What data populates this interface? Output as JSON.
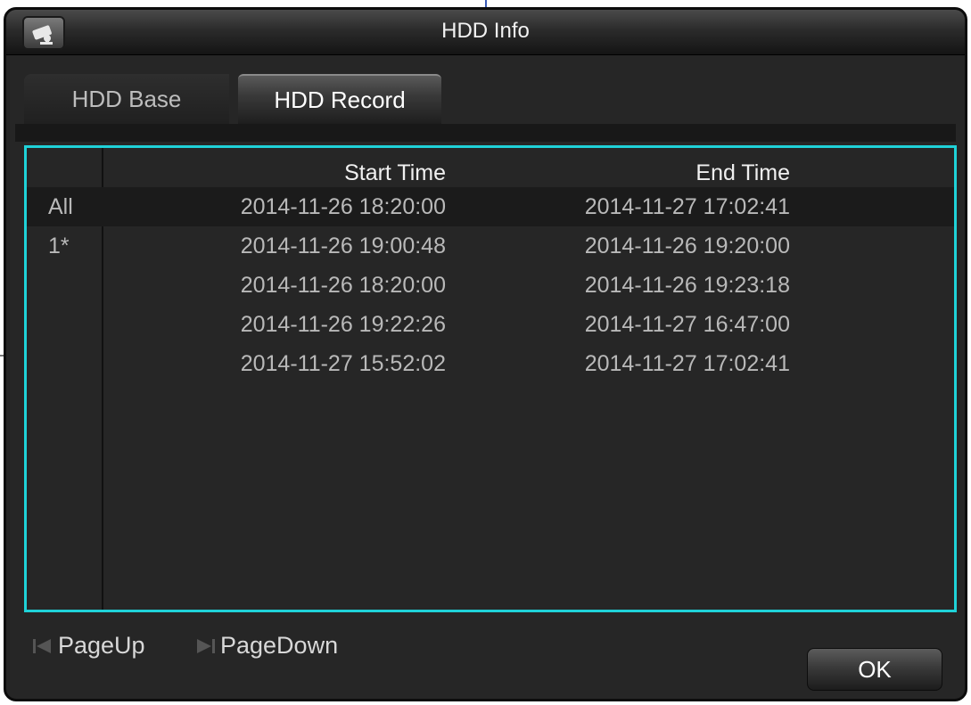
{
  "window": {
    "title": "HDD Info",
    "icon": "camera-icon"
  },
  "tabs": [
    {
      "label": "HDD Base",
      "active": false
    },
    {
      "label": "HDD Record",
      "active": true
    }
  ],
  "table": {
    "columns": [
      "",
      "Start Time",
      "End Time"
    ],
    "rows": [
      {
        "label": "All",
        "start": "2014-11-26 18:20:00",
        "end": "2014-11-27 17:02:41",
        "selected": true
      },
      {
        "label": "1*",
        "start": "2014-11-26 19:00:48",
        "end": "2014-11-26 19:20:00",
        "selected": false
      },
      {
        "label": "",
        "start": "2014-11-26 18:20:00",
        "end": "2014-11-26 19:23:18",
        "selected": false
      },
      {
        "label": "",
        "start": "2014-11-26 19:22:26",
        "end": "2014-11-27 16:47:00",
        "selected": false
      },
      {
        "label": "",
        "start": "2014-11-27 15:52:02",
        "end": "2014-11-27 17:02:41",
        "selected": false
      }
    ]
  },
  "footer": {
    "page_up_label": "PageUp",
    "page_down_label": "PageDown",
    "ok_label": "OK"
  },
  "colors": {
    "accent_border": "#1fd2d8",
    "background": "#262626",
    "text_primary": "#f0f0f0",
    "text_secondary": "#b9b9b9"
  }
}
